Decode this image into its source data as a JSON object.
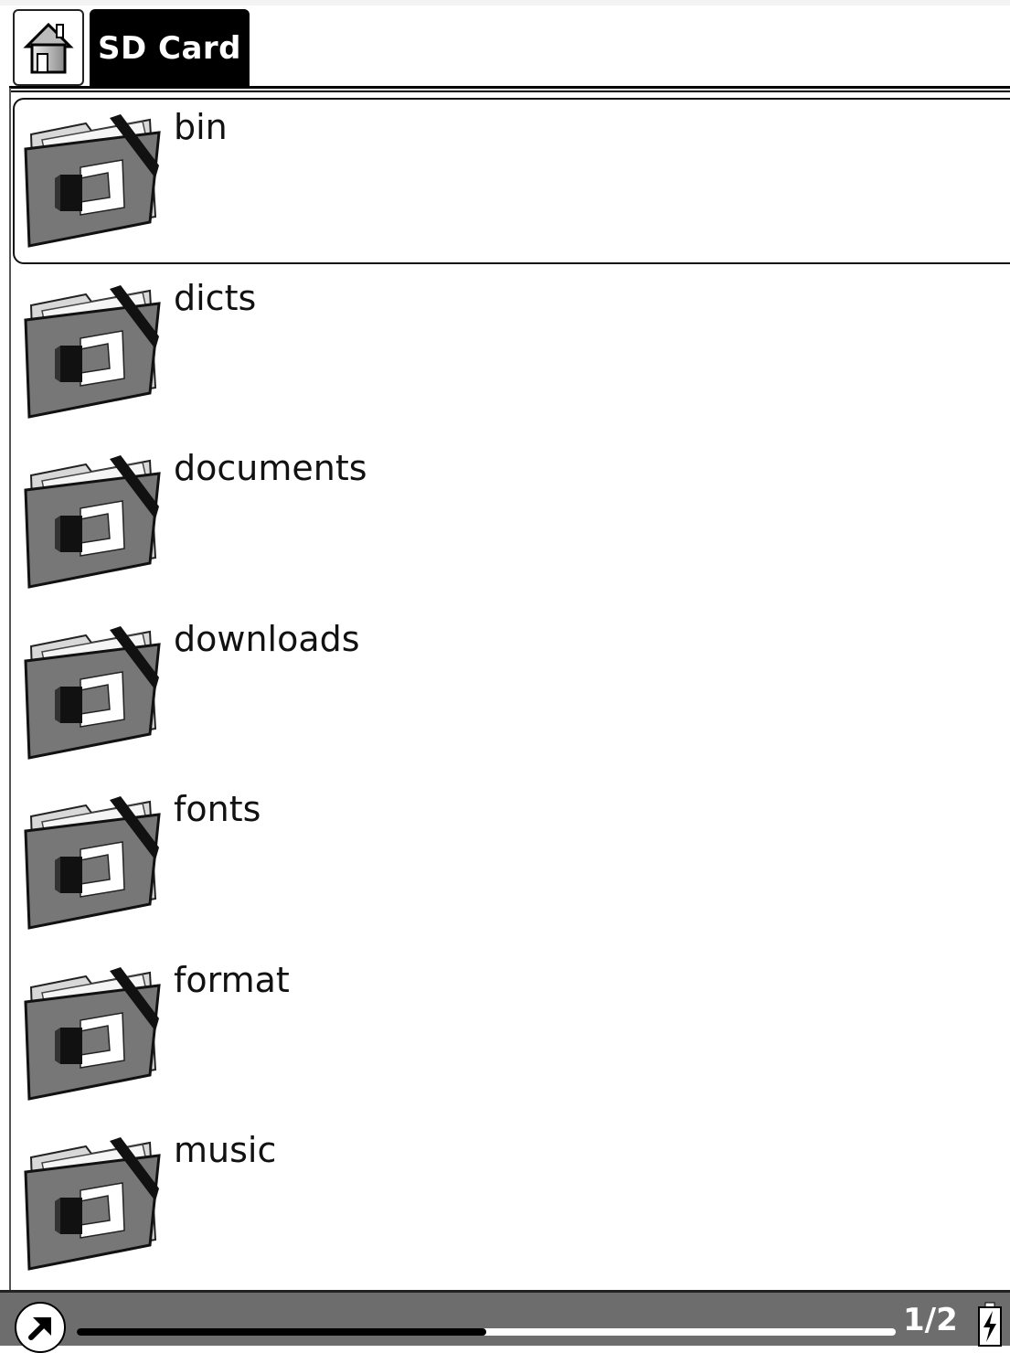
{
  "header": {
    "home_icon": "home-icon",
    "tab_label": "SD Card"
  },
  "file_list": {
    "selected_index": 0,
    "items": [
      {
        "name": "bin",
        "icon": "folder-icon"
      },
      {
        "name": "dicts",
        "icon": "folder-icon"
      },
      {
        "name": "documents",
        "icon": "folder-icon"
      },
      {
        "name": "downloads",
        "icon": "folder-icon"
      },
      {
        "name": "fonts",
        "icon": "folder-icon"
      },
      {
        "name": "format",
        "icon": "folder-icon"
      },
      {
        "name": "music",
        "icon": "folder-icon"
      }
    ]
  },
  "footer": {
    "nav_icon": "arrow-up-right-icon",
    "progress_fraction": 0.5,
    "page_indicator": "1/2",
    "battery_icon": "battery-charging-icon"
  },
  "colors": {
    "background": "#ffffff",
    "tab_background": "#000000",
    "footer_background": "#6d6d6d"
  }
}
